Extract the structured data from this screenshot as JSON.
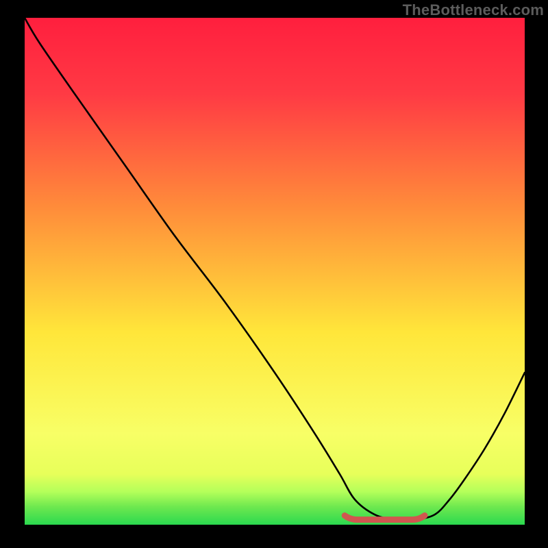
{
  "watermark": "TheBottleneck.com",
  "colors": {
    "background": "#000000",
    "watermark": "#5c5c5c",
    "gradient_top": "#ff1f3e",
    "gradient_upper_mid": "#ff8e3a",
    "gradient_mid": "#ffe63a",
    "gradient_lower_light": "#f8ff66",
    "gradient_green_light": "#b4ff5a",
    "gradient_green": "#2bd94f",
    "curve": "#000000",
    "highlight": "#d1564f"
  },
  "chart_data": {
    "type": "line",
    "title": "",
    "xlabel": "",
    "ylabel": "",
    "xlim": [
      0,
      100
    ],
    "ylim": [
      0,
      100
    ],
    "grid": false,
    "legend": false,
    "description": "Bottleneck curve over a red-yellow-green vertical gradient; minimum (flat valley) near the right side with a thick red flat highlight segment.",
    "series": [
      {
        "name": "bottleneck-curve",
        "x": [
          0,
          3,
          10,
          20,
          30,
          40,
          50,
          58,
          63,
          66,
          70,
          74,
          78,
          82,
          85,
          88,
          92,
          96,
          100
        ],
        "values": [
          100,
          95,
          85,
          71,
          57,
          44,
          30,
          18,
          10,
          5,
          2,
          1,
          1,
          2,
          5,
          9,
          15,
          22,
          30
        ]
      }
    ],
    "flat_valley_highlight": {
      "x_start": 64,
      "x_end": 80,
      "y": 1
    },
    "gradient_stops": [
      {
        "offset": 0.0,
        "color": "#ff1f3e"
      },
      {
        "offset": 0.15,
        "color": "#ff3a44"
      },
      {
        "offset": 0.38,
        "color": "#ff8e3a"
      },
      {
        "offset": 0.62,
        "color": "#ffe63a"
      },
      {
        "offset": 0.82,
        "color": "#f8ff66"
      },
      {
        "offset": 0.9,
        "color": "#e7ff5a"
      },
      {
        "offset": 0.935,
        "color": "#b4ff5a"
      },
      {
        "offset": 0.965,
        "color": "#6de84f"
      },
      {
        "offset": 1.0,
        "color": "#2bd94f"
      }
    ]
  }
}
